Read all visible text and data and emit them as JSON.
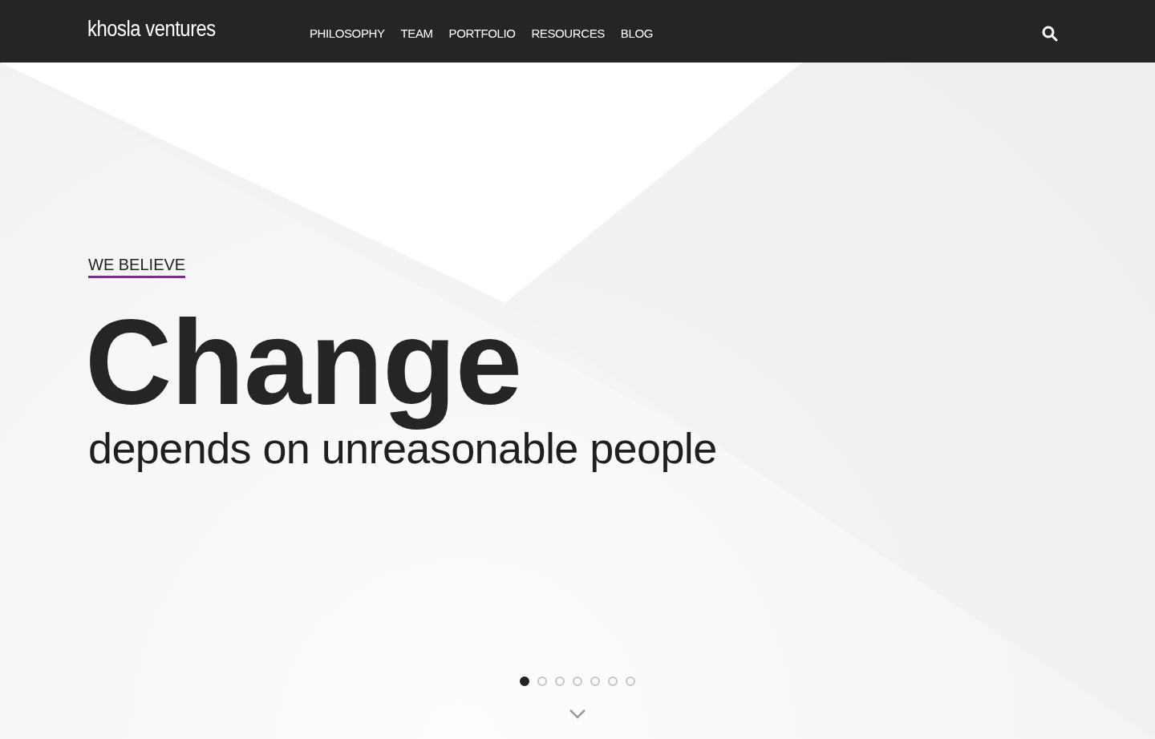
{
  "header": {
    "logo": "khosla ventures",
    "nav": [
      {
        "label": "PHILOSOPHY"
      },
      {
        "label": "TEAM"
      },
      {
        "label": "PORTFOLIO"
      },
      {
        "label": "RESOURCES"
      },
      {
        "label": "BLOG"
      }
    ]
  },
  "hero": {
    "eyebrow": "WE BELIEVE",
    "headline": "Change",
    "subline": "depends on unreasonable people"
  },
  "slides": [
    {
      "selected": true
    },
    {
      "selected": false
    },
    {
      "selected": false
    },
    {
      "selected": false
    },
    {
      "selected": false
    },
    {
      "selected": false
    },
    {
      "selected": false
    }
  ]
}
